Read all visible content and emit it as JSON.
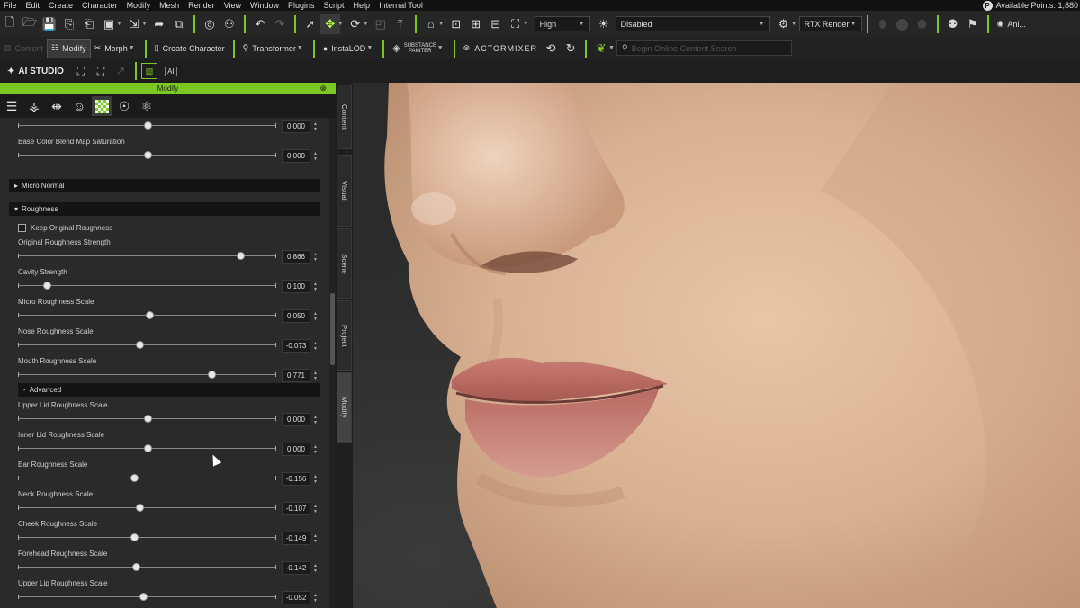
{
  "menubar": {
    "items": [
      "File",
      "Edit",
      "Create",
      "Character",
      "Modify",
      "Mesh",
      "Render",
      "View",
      "Window",
      "Plugins",
      "Script",
      "Help",
      "Internal Tool"
    ],
    "points_label": "Available Points: 1,880",
    "points_badge": "P"
  },
  "toolbar1": {
    "quality_value": "High",
    "mode_value": "Disabled",
    "render_value": "RTX Render",
    "ani_label": "Ani..."
  },
  "toolbar2": {
    "content_label": "Content",
    "modify_label": "Modify",
    "morph_label": "Morph",
    "create_character_label": "Create Character",
    "transformer_label": "Transformer",
    "instalod_label": "InstaLOD",
    "substance_label": "SUBSTANCE PAINTER",
    "actormixer_label": "ACTORMIXER",
    "search_placeholder": "Begin Online Content Search"
  },
  "toolbar3": {
    "ai_studio_label": "AI STUDIO",
    "ai_label": "AI"
  },
  "panel": {
    "title": "Modify",
    "vtabs": [
      "Content",
      "Visual",
      "Scene",
      "Project",
      "Modify"
    ],
    "sliders_top": [
      {
        "label": "",
        "value": "0.000",
        "fraction": 0.5
      },
      {
        "label": "Base Color Blend Map Saturation",
        "value": "0.000",
        "fraction": 0.5
      }
    ],
    "section_micro_normal": "Micro Normal",
    "section_roughness": "Roughness",
    "keep_original_label": "Keep Original Roughness",
    "keep_original_checked": false,
    "roughness_sliders": [
      {
        "label": "Original Roughness Strength",
        "value": "0.866",
        "fraction": 0.86
      },
      {
        "label": "Cavity Strength",
        "value": "0.100",
        "fraction": 0.11
      },
      {
        "label": "Micro Roughness Scale",
        "value": "0.050",
        "fraction": 0.51
      },
      {
        "label": "Nose Roughness Scale",
        "value": "-0.073",
        "fraction": 0.47
      },
      {
        "label": "Mouth Roughness Scale",
        "value": "0.771",
        "fraction": 0.75
      }
    ],
    "section_advanced": "Advanced",
    "advanced_sliders": [
      {
        "label": "Upper Lid Roughness Scale",
        "value": "0.000",
        "fraction": 0.5
      },
      {
        "label": "Inner Lid Roughness Scale",
        "value": "0.000",
        "fraction": 0.5
      },
      {
        "label": "Ear Roughness Scale",
        "value": "-0.156",
        "fraction": 0.45
      },
      {
        "label": "Neck Roughness Scale",
        "value": "-0.107",
        "fraction": 0.47
      },
      {
        "label": "Cheek Roughness Scale",
        "value": "-0.149",
        "fraction": 0.45
      },
      {
        "label": "Forehead Roughness Scale",
        "value": "-0.142",
        "fraction": 0.455
      },
      {
        "label": "Upper Lip Roughness Scale",
        "value": "-0.052",
        "fraction": 0.485
      }
    ]
  }
}
